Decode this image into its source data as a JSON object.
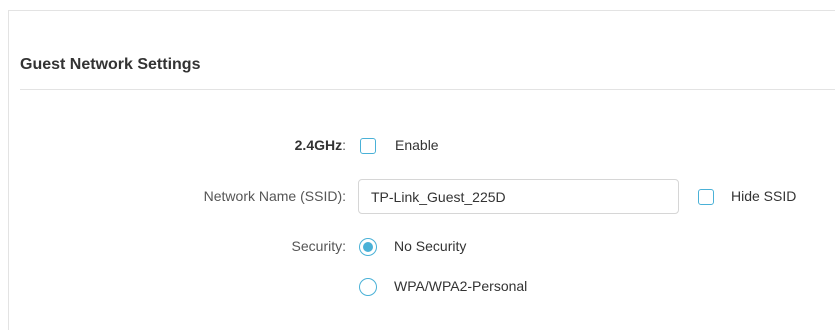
{
  "section": {
    "title": "Guest Network Settings"
  },
  "band": {
    "label": "2.4GHz",
    "colon": ":",
    "enable_label": "Enable",
    "enable_checked": false
  },
  "ssid": {
    "label": "Network Name (SSID):",
    "value": "TP-Link_Guest_225D",
    "hide_label": "Hide SSID",
    "hide_checked": false
  },
  "security": {
    "label": "Security:",
    "options": [
      {
        "label": "No Security",
        "selected": true
      },
      {
        "label": "WPA/WPA2-Personal",
        "selected": false
      }
    ]
  },
  "colors": {
    "accent": "#4ab1d7",
    "border": "#e3e3e3",
    "text": "#333333",
    "label_text": "#555555"
  }
}
